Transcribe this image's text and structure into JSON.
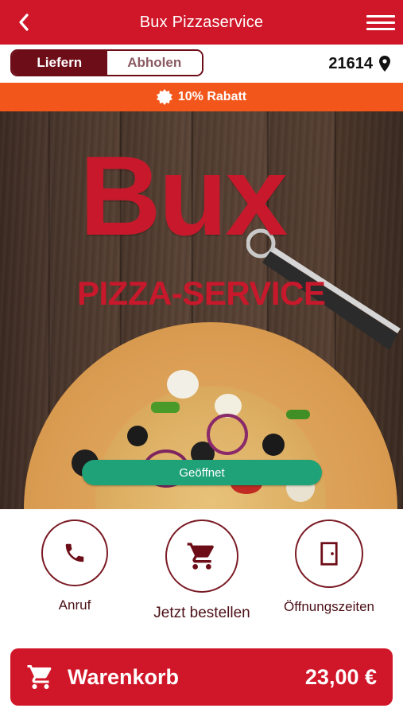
{
  "header": {
    "title": "Bux Pizzaservice",
    "back_icon": "chevron-left-icon",
    "menu_icon": "hamburger-menu-icon"
  },
  "order_mode": {
    "options": [
      {
        "label": "Liefern",
        "active": true
      },
      {
        "label": "Abholen",
        "active": false
      }
    ]
  },
  "location": {
    "zip": "21614",
    "icon": "map-pin-icon"
  },
  "discount": {
    "label": "10% Rabatt",
    "icon": "badge-icon"
  },
  "hero": {
    "logo_main": "Bux",
    "logo_sub": "PIZZA-SERVICE",
    "status": "Geöffnet"
  },
  "actions": [
    {
      "label": "Anruf",
      "icon": "phone-icon"
    },
    {
      "label": "Jetzt bestellen",
      "icon": "cart-icon"
    },
    {
      "label": "Öffnungszeiten",
      "icon": "door-icon"
    }
  ],
  "cart": {
    "label": "Warenkorb",
    "total": "23,00 €",
    "icon": "cart-icon"
  },
  "colors": {
    "brand_red": "#d01729",
    "dark_red": "#6d0d18",
    "orange": "#f2561b",
    "green": "#1fa277"
  }
}
